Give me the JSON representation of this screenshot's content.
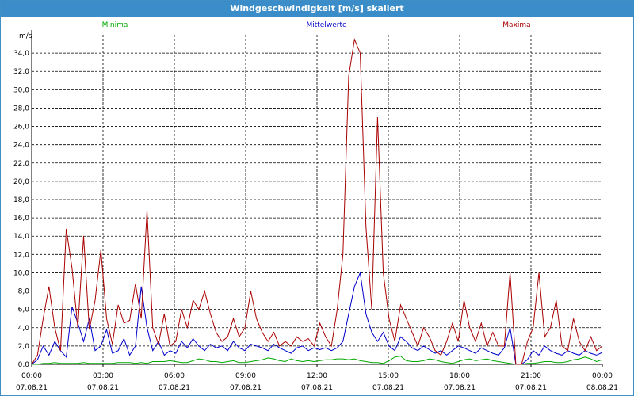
{
  "window": {
    "title": "Windgeschwindigkeit [m/s] skaliert"
  },
  "chart_data": {
    "type": "line",
    "title": "Windgeschwindigkeit [m/s] skaliert",
    "ylabel": "m/s",
    "ylim": [
      0,
      36
    ],
    "yticks": [
      "0,0",
      "2,0",
      "4,0",
      "6,0",
      "8,0",
      "10,0",
      "12,0",
      "14,0",
      "16,0",
      "18,0",
      "20,0",
      "22,0",
      "24,0",
      "26,0",
      "28,0",
      "30,0",
      "32,0",
      "34,0"
    ],
    "xticks": [
      {
        "time": "00:00",
        "date": "07.08.21"
      },
      {
        "time": "03:00",
        "date": "07.08.21"
      },
      {
        "time": "06:00",
        "date": "07.08.21"
      },
      {
        "time": "09:00",
        "date": "07.08.21"
      },
      {
        "time": "12:00",
        "date": "07.08.21"
      },
      {
        "time": "15:00",
        "date": "07.08.21"
      },
      {
        "time": "18:00",
        "date": "07.08.21"
      },
      {
        "time": "21:00",
        "date": "07.08.21"
      },
      {
        "time": "00:00",
        "date": "08.08.21"
      }
    ],
    "grid": true,
    "legend_position": "top",
    "series": [
      {
        "name": "Minima",
        "color": "#00aa00",
        "values": [
          0.0,
          0.0,
          0.1,
          0.1,
          0.2,
          0.1,
          0.1,
          0.1,
          0.1,
          0.2,
          0.1,
          0.1,
          0.1,
          0.1,
          0.1,
          0.2,
          0.2,
          0.2,
          0.1,
          0.2,
          0.1,
          0.3,
          0.3,
          0.3,
          0.4,
          0.3,
          0.2,
          0.2,
          0.4,
          0.6,
          0.5,
          0.3,
          0.3,
          0.2,
          0.3,
          0.4,
          0.2,
          0.2,
          0.3,
          0.4,
          0.5,
          0.7,
          0.6,
          0.4,
          0.3,
          0.6,
          0.4,
          0.3,
          0.4,
          0.3,
          0.4,
          0.5,
          0.5,
          0.6,
          0.6,
          0.5,
          0.6,
          0.4,
          0.3,
          0.2,
          0.2,
          0.1,
          0.4,
          0.8,
          0.9,
          0.4,
          0.3,
          0.3,
          0.4,
          0.6,
          0.5,
          0.3,
          0.2,
          0.1,
          0.3,
          0.5,
          0.6,
          0.4,
          0.5,
          0.6,
          0.4,
          0.3,
          0.2,
          0.1,
          0.0,
          0.0,
          0.1,
          0.1,
          0.2,
          0.3,
          0.3,
          0.2,
          0.2,
          0.3,
          0.5,
          0.6,
          0.8,
          0.6,
          0.3,
          0.5
        ]
      },
      {
        "name": "Mittelwerte",
        "color": "#0000cc",
        "values": [
          0.0,
          0.5,
          2.0,
          1.0,
          2.5,
          1.5,
          0.8,
          6.3,
          4.5,
          2.5,
          5.0,
          1.5,
          2.0,
          3.8,
          1.2,
          1.5,
          2.8,
          1.0,
          2.0,
          8.5,
          4.0,
          1.5,
          2.5,
          1.0,
          1.5,
          1.2,
          2.5,
          1.8,
          2.8,
          2.0,
          1.5,
          2.2,
          1.8,
          2.0,
          1.5,
          2.5,
          1.8,
          1.5,
          2.2,
          2.0,
          1.8,
          1.5,
          2.2,
          1.8,
          1.5,
          1.2,
          1.8,
          2.0,
          1.5,
          1.8,
          1.6,
          1.8,
          1.5,
          1.8,
          2.5,
          5.5,
          8.5,
          10.0,
          5.5,
          3.5,
          2.5,
          3.5,
          2.0,
          1.5,
          3.0,
          2.5,
          1.8,
          1.5,
          2.0,
          1.6,
          1.2,
          1.5,
          1.0,
          1.5,
          2.0,
          1.8,
          1.5,
          1.2,
          1.8,
          1.5,
          1.2,
          1.0,
          1.8,
          4.0,
          0.0,
          0.0,
          0.5,
          1.5,
          1.0,
          2.0,
          1.5,
          1.2,
          1.0,
          1.5,
          1.2,
          1.0,
          1.5,
          1.2,
          1.0,
          1.3
        ]
      },
      {
        "name": "Maxima",
        "color": "#aa0000",
        "values": [
          0.0,
          1.0,
          5.0,
          8.5,
          4.0,
          1.5,
          14.8,
          10.5,
          4.0,
          14.0,
          3.8,
          7.0,
          12.5,
          5.0,
          2.2,
          6.5,
          4.5,
          4.8,
          8.8,
          5.0,
          16.8,
          4.0,
          2.2,
          5.5,
          2.0,
          2.5,
          6.0,
          4.0,
          7.0,
          6.0,
          8.0,
          5.5,
          3.5,
          2.5,
          3.0,
          5.0,
          3.0,
          4.0,
          8.0,
          5.0,
          3.5,
          2.5,
          3.5,
          2.0,
          2.5,
          2.0,
          3.0,
          2.5,
          2.8,
          2.0,
          4.5,
          3.0,
          2.0,
          6.0,
          12.0,
          31.5,
          35.5,
          34.0,
          15.0,
          6.0,
          27.0,
          10.0,
          5.0,
          2.5,
          6.5,
          5.0,
          3.5,
          2.0,
          4.0,
          3.0,
          1.5,
          1.0,
          2.5,
          4.5,
          2.5,
          7.0,
          4.0,
          2.5,
          4.5,
          2.0,
          3.5,
          2.0,
          2.0,
          10.0,
          0.0,
          0.0,
          2.5,
          4.0,
          10.0,
          3.0,
          4.0,
          7.0,
          2.0,
          1.5,
          5.0,
          2.5,
          1.5,
          3.0,
          1.5,
          2.0
        ]
      }
    ]
  }
}
